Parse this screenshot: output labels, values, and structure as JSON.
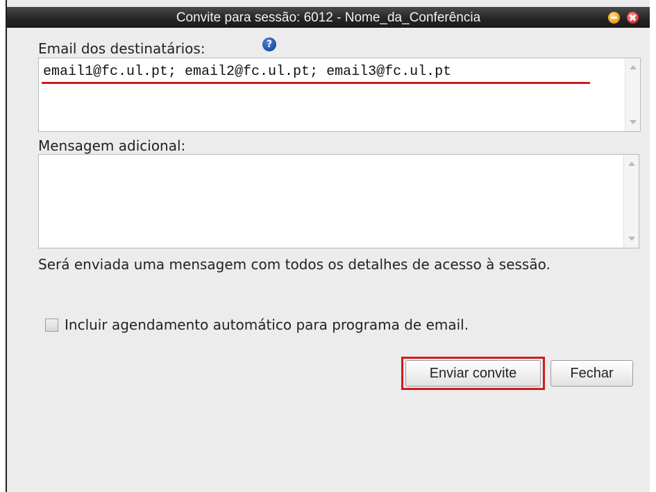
{
  "window": {
    "title": "Convite para sessão: 6012 - Nome_da_Conferência"
  },
  "form": {
    "recipients_label": "Email dos destinatários:",
    "recipients_value": "email1@fc.ul.pt; email2@fc.ul.pt; email3@fc.ul.pt",
    "message_label": "Mensagem adicional:",
    "message_value": "",
    "info_text": "Será enviada uma mensagem com todos os detalhes de acesso à sessão.",
    "schedule_checkbox_label": "Incluir agendamento automático para programa de email.",
    "schedule_checked": false
  },
  "buttons": {
    "send_label": "Enviar convite",
    "close_label": "Fechar"
  },
  "colors": {
    "titlebar": "#262626",
    "highlight_red": "#d11a1a",
    "dialog_bg": "#ececec"
  },
  "icons": {
    "help": "help-icon",
    "minimize": "minimize-icon",
    "close": "close-icon"
  }
}
